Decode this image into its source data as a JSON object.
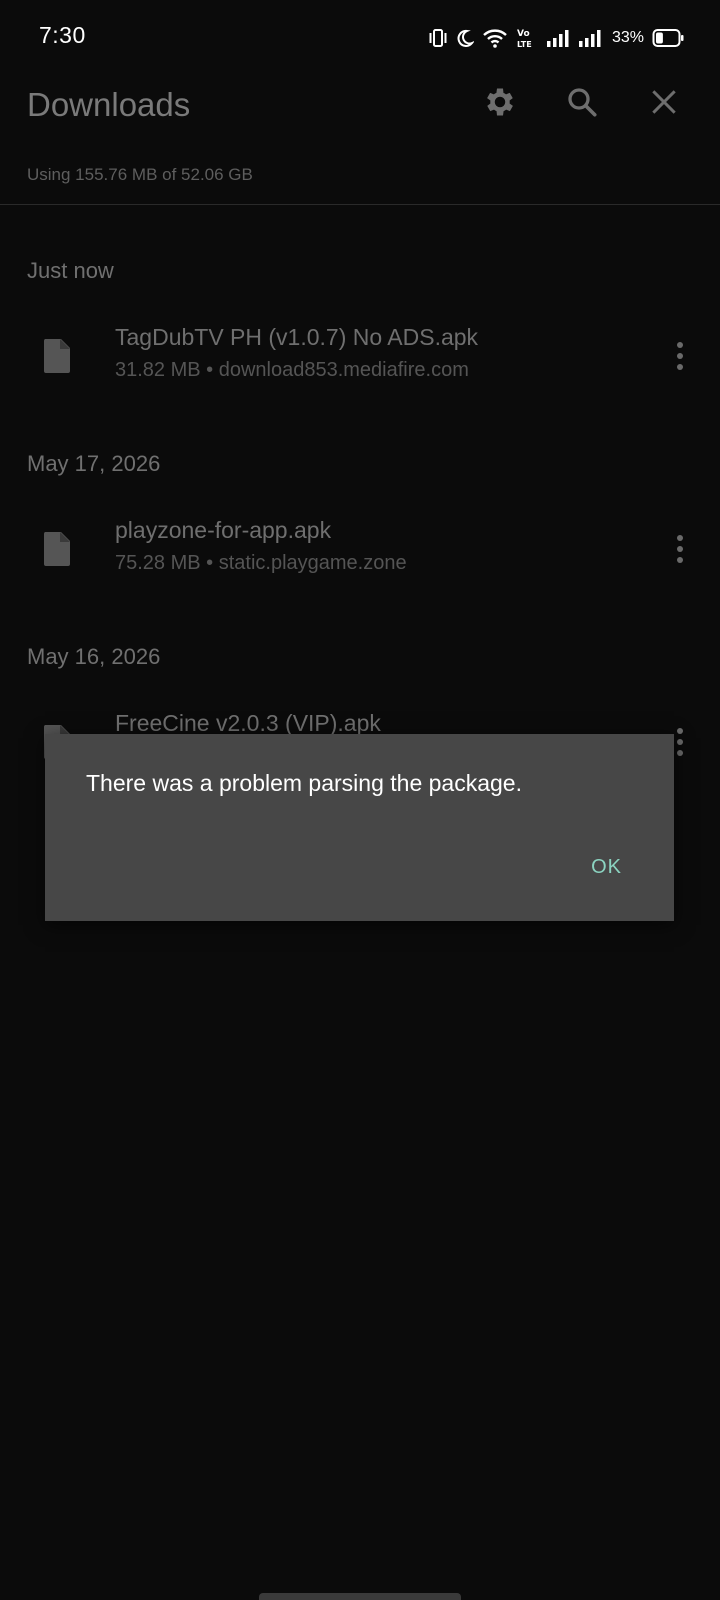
{
  "status_bar": {
    "time": "7:30",
    "battery_percent": "33%",
    "battery_level": 0.33,
    "icons": [
      "vibrate-icon",
      "do-not-disturb-moon-icon",
      "wifi-icon",
      "volte-icon",
      "signal-icon",
      "signal-icon",
      "battery-icon"
    ]
  },
  "app_bar": {
    "title": "Downloads",
    "settings_icon": "gear-icon",
    "search_icon": "search-icon",
    "close_icon": "close-icon"
  },
  "storage": {
    "text": "Using 155.76 MB of 52.06 GB"
  },
  "sections": [
    {
      "header": "Just now",
      "items": [
        {
          "name": "TagDubTV PH (v1.0.7) No ADS.apk",
          "meta": "31.82 MB • download853.mediafire.com"
        }
      ]
    },
    {
      "header": "May 17, 2026",
      "items": [
        {
          "name": "playzone-for-app.apk",
          "meta": "75.28 MB • static.playgame.zone"
        }
      ]
    },
    {
      "header": "May 16, 2026",
      "items": [
        {
          "name": "FreeCine v2.0.3 (VIP).apk",
          "meta": ""
        }
      ]
    }
  ],
  "dialog": {
    "message": "There was a problem parsing the package.",
    "ok_label": "OK"
  },
  "colors": {
    "background": "#0b0b0b",
    "dialog_background": "#474747",
    "dialog_button": "#8bd3c0"
  }
}
